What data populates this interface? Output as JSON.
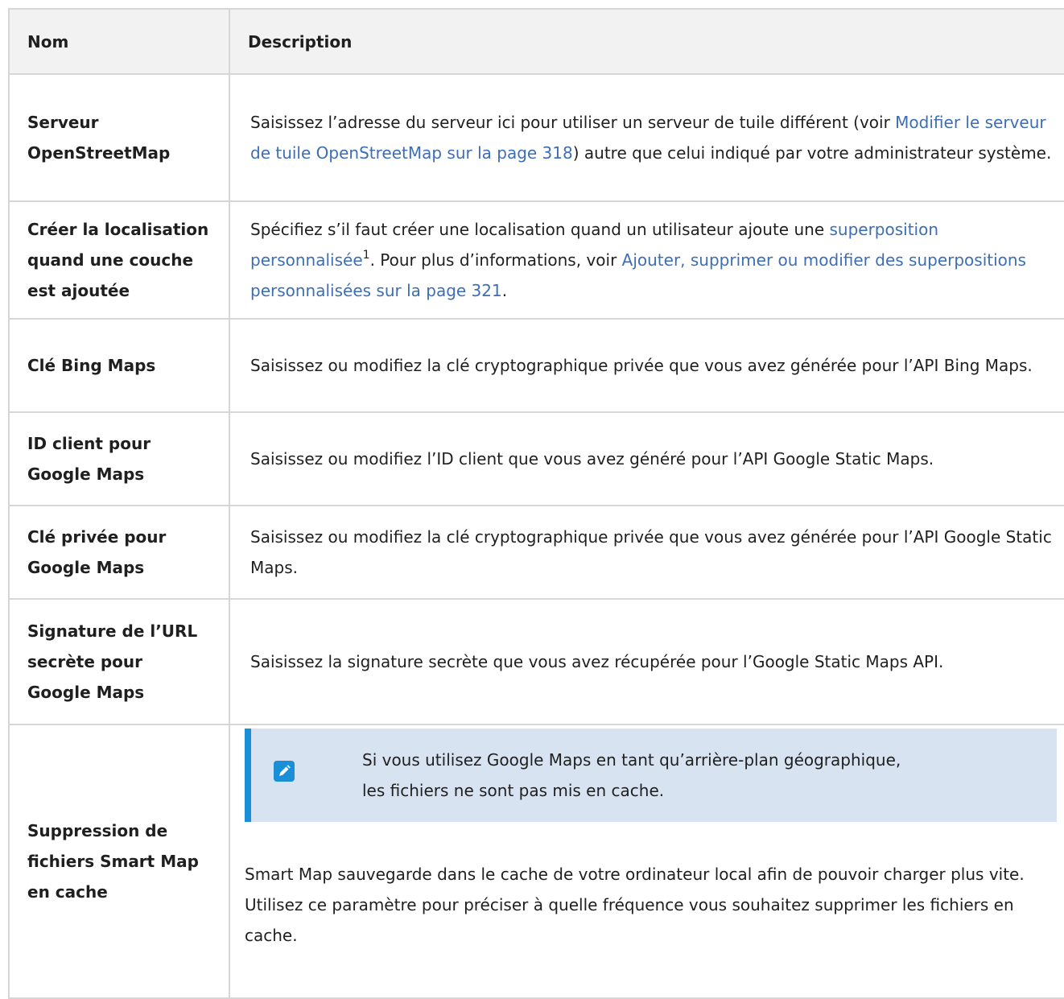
{
  "table": {
    "headers": {
      "name": "Nom",
      "description": "Description"
    },
    "rows": [
      {
        "name": "Serveur OpenStreetMap",
        "desc_before": "Saisissez l’adresse du serveur ici pour utiliser un serveur de tuile différent (voir ",
        "desc_link": "Modifier le serveur de tuile OpenStreetMap sur la page 318",
        "desc_after": ") autre que celui indiqué par votre administrateur système."
      },
      {
        "name": "Créer la localisation quand une couche est ajoutée",
        "desc_before": "Spécifiez s’il faut créer une localisation quand un utilisateur ajoute une ",
        "desc_link_glossary": "superposition personnalisée",
        "footnote": "1",
        "desc_middle": ". Pour plus d’informations, voir ",
        "desc_link": "Ajouter, supprimer ou modifier des superpositions personnalisées sur la page 321",
        "desc_after": "."
      },
      {
        "name": "Clé Bing Maps",
        "desc": "Saisissez ou modifiez la clé cryptographique privée que vous avez générée pour l’API Bing Maps."
      },
      {
        "name": "ID client pour Google Maps",
        "desc": "Saisissez ou modifiez l’ID client que vous avez généré pour l’API Google Static Maps."
      },
      {
        "name": "Clé privée pour Google Maps",
        "desc": "Saisissez ou modifiez la clé cryptographique privée que vous avez générée pour l’API Google Static Maps."
      },
      {
        "name": "Signature de l’URL secrète pour Google Maps",
        "desc": "Saisissez la signature secrète que vous avez récupérée pour l’Google Static Maps API."
      },
      {
        "name": "Suppression de fichiers Smart Map en cache",
        "note_line1": "Si vous utilisez Google Maps en tant qu’arrière-plan géographique,",
        "note_line2": "les fichiers ne sont pas mis en cache.",
        "note_icon": "pencil-icon",
        "desc": "Smart Map sauvegarde dans le cache de votre ordinateur local afin de pouvoir charger plus vite. Utilisez ce paramètre pour préciser à quelle fréquence vous souhaitez supprimer les fichiers en cache."
      }
    ]
  },
  "colors": {
    "link": "#3d6eb5",
    "note_bg": "#d8e3f1",
    "note_accent": "#1a8fd8",
    "header_bg": "#f2f2f2",
    "border": "#d6d6d6"
  }
}
